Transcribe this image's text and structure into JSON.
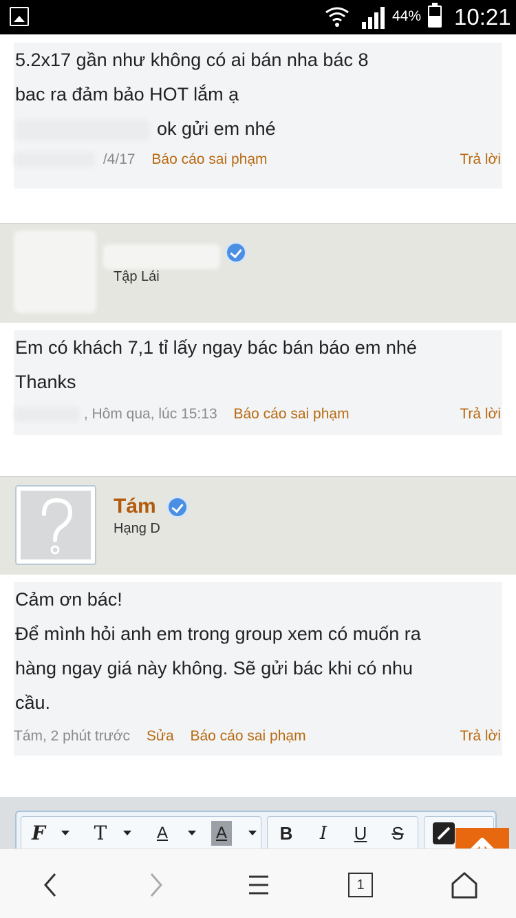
{
  "status_bar": {
    "battery": "44%",
    "time": "10:21"
  },
  "posts": [
    {
      "lines": [
        "5.2x17 gần như không có ai bán nha bác 8",
        "bac ra đảm bảo HOT lắm ạ",
        "ok gửi em nhé"
      ],
      "date": "/4/17",
      "report": "Báo cáo sai phạm",
      "reply": "Trả lời"
    },
    {
      "rank": "Tập Lái",
      "lines": [
        "Em có khách 7,1 tỉ lấy ngay bác bán báo em nhé",
        "Thanks"
      ],
      "date": ", Hôm qua, lúc 15:13",
      "report": "Báo cáo sai phạm",
      "reply": "Trả lời"
    },
    {
      "name": "Tám",
      "rank": "Hạng D",
      "lines": [
        "Cảm ơn bác!",
        "Để mình hỏi anh em trong group xem có muốn ra",
        "hàng ngay giá này không. Sẽ gửi bác khi có nhu",
        "cầu."
      ],
      "date": "Tám, 2 phút trước",
      "edit": "Sửa",
      "report": "Báo cáo sai phạm",
      "reply": "Trả lời"
    }
  ],
  "toolbar": {
    "font_label": "F",
    "size_label": "T",
    "color_label": "A",
    "bg_label": "A",
    "bold": "B",
    "italic": "I",
    "underline": "U",
    "strike": "S"
  },
  "nav": {
    "tabs_count": "1"
  },
  "icons": [
    "gallery-icon",
    "wifi-icon",
    "signal-icon",
    "battery-icon",
    "verified-icon",
    "scroll-top-icon",
    "back-icon",
    "forward-icon",
    "menu-icon",
    "tabs-icon",
    "home-icon"
  ],
  "colors": {
    "accent": "#b86a10",
    "username": "#b25a0b",
    "scroll_top": "#e8680f",
    "verified": "#4a8fe3"
  }
}
